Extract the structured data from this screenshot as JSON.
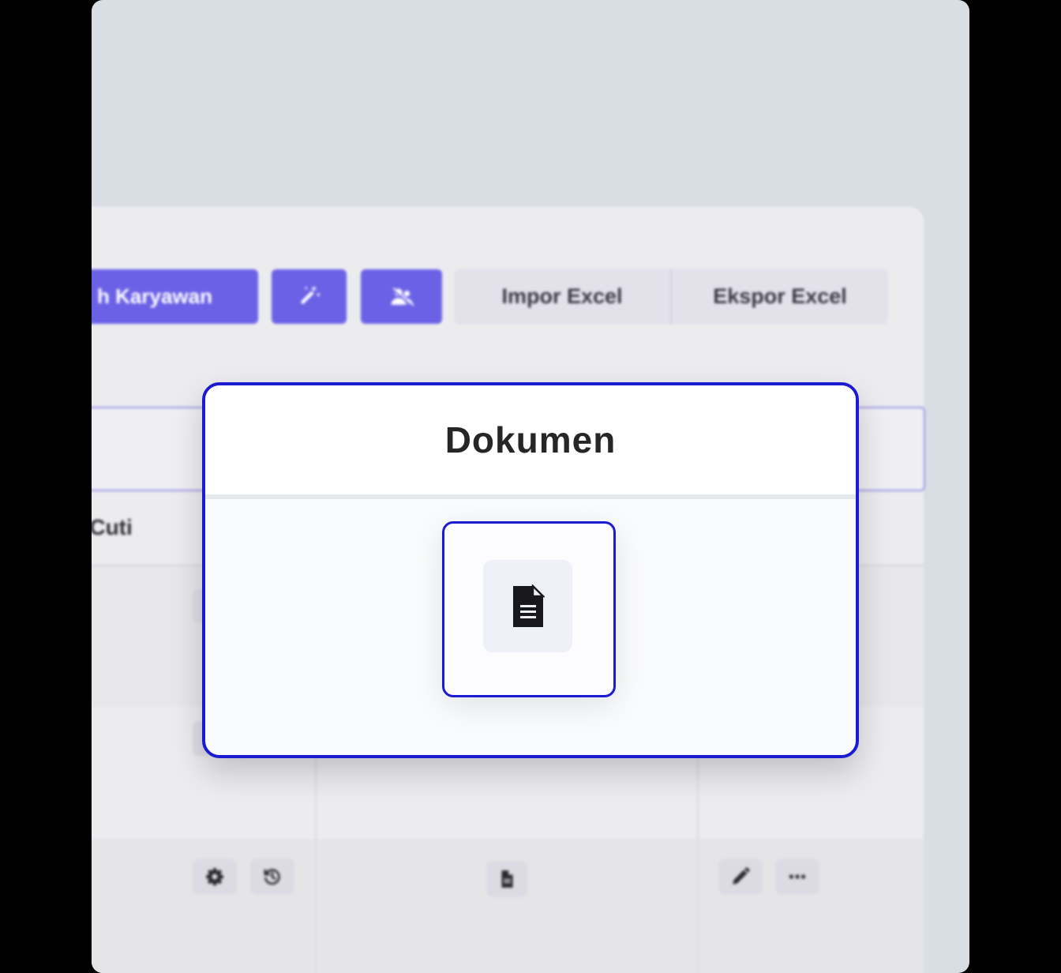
{
  "toolbar": {
    "add_employee_label": "h Karyawan",
    "import_excel_label": "Impor Excel",
    "export_excel_label": "Ekspor Excel"
  },
  "table": {
    "visible_header": "a Cuti"
  },
  "modal": {
    "title": "Dokumen",
    "items": [
      {
        "icon": "document-icon"
      }
    ]
  },
  "icons": {
    "wand": "magic-wand-icon",
    "users": "users-off-icon",
    "settings": "gear-icon",
    "history": "history-icon",
    "document": "document-icon",
    "edit": "pencil-icon",
    "more": "more-horizontal-icon"
  },
  "colors": {
    "primary": "#6b61e6",
    "focus_outline": "#1b1bd1",
    "search_border": "#9d95e6"
  }
}
